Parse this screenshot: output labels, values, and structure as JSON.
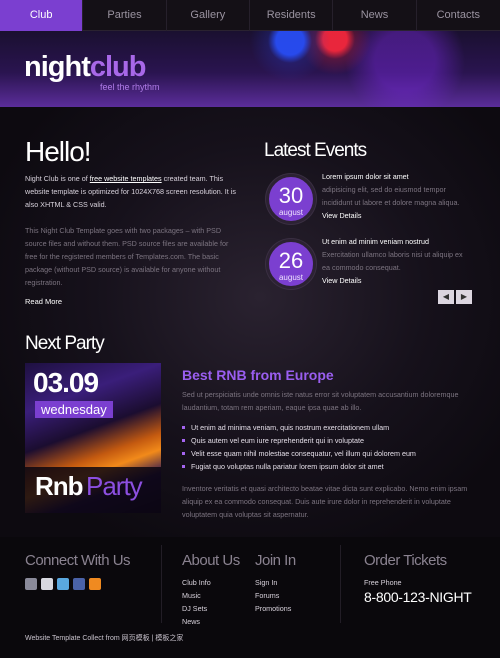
{
  "nav": {
    "items": [
      {
        "label": "Club"
      },
      {
        "label": "Parties"
      },
      {
        "label": "Gallery"
      },
      {
        "label": "Residents"
      },
      {
        "label": "News"
      },
      {
        "label": "Contacts"
      }
    ],
    "active_index": 0
  },
  "header": {
    "logo_word1": "night",
    "logo_word2": "club",
    "slogan": "feel the rhythm"
  },
  "hello": {
    "title": "Hello!",
    "p1_before": "Night Club is one of ",
    "p1_link": "free website templates",
    "p1_after": " created team. This website template is optimized for 1024X768 screen resolution. It is also XHTML & CSS valid.",
    "p2": "This Night Club Template goes with two packages – with PSD source files and without them. PSD source files are available for free for the registered members of Templates.com. The basic package (without PSD source) is available for anyone without registration.",
    "read_more": "Read More"
  },
  "events": {
    "title": "Latest Events",
    "items": [
      {
        "day": "30",
        "month": "august",
        "head": "Lorem ipsum dolor sit amet",
        "text": "adipisicing elit, sed do eiusmod tempor incididunt ut labore et dolore magna aliqua.",
        "details": "View Details"
      },
      {
        "day": "26",
        "month": "august",
        "head": "Ut enim ad minim veniam nostrud",
        "text": "Exercitation ullamco laboris nisi ut aliquip ex ea commodo consequat.",
        "details": "View Details"
      }
    ],
    "prev": "◀",
    "next": "▶"
  },
  "party": {
    "title": "Next Party",
    "date": "03.09",
    "weekday": "wednesday",
    "name1": "Rnb",
    "name2": "Party"
  },
  "rnb": {
    "title": "Best RNB from Europe",
    "p1": "Sed ut perspiciatis unde omnis iste natus error sit voluptatem accusantium doloremque laudantium, totam rem aperiam, eaque ipsa quae ab illo.",
    "bullets": [
      "Ut enim ad minima veniam, quis nostrum exercitationem ullam",
      "Quis autem vel eum iure reprehenderit qui in voluptate",
      "Velit esse quam nihil molestiae consequatur, vel illum qui dolorem eum",
      "Fugiat quo voluptas nulla pariatur lorem ipsum dolor sit amet"
    ],
    "p2": "Inventore veritatis et quasi architecto beatae vitae dicta sunt explicabo. Nemo enim ipsam aliquip ex ea commodo consequat. Duis aute irure dolor in reprehenderit in voluptate voluptatem quia voluptas sit aspernatur."
  },
  "footer": {
    "connect_title": "Connect With Us",
    "social_icons": [
      "email-icon",
      "flickr-icon",
      "twitter-icon",
      "facebook-icon",
      "rss-icon"
    ],
    "about_title": "About Us",
    "about_links": [
      "Club Info",
      "Music",
      "DJ Sets",
      "News"
    ],
    "join_title": "Join In",
    "join_links": [
      "Sign In",
      "Forums",
      "Promotions"
    ],
    "order_title": "Order Tickets",
    "phone_label": "Free Phone",
    "phone": "8-800-123-NIGHT",
    "copyright": "Website Template Collect from 网页模板 | 模板之家"
  },
  "colors": {
    "accent": "#7b3fd0",
    "accent_light": "#9a5ef0",
    "background": "#0b0810"
  }
}
